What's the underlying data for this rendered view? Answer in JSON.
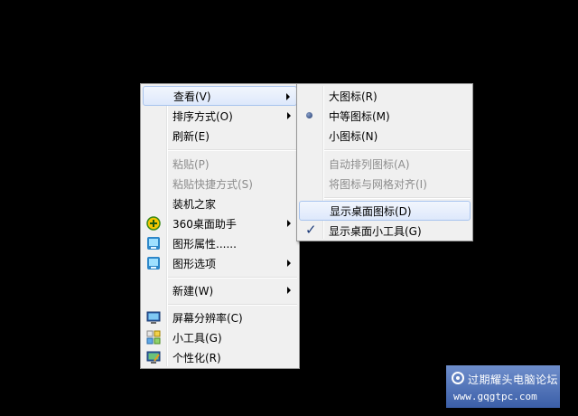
{
  "main_menu": {
    "items": [
      {
        "label": "查看(V)",
        "has_submenu": true,
        "highlighted": true,
        "disabled": false
      },
      {
        "label": "排序方式(O)",
        "has_submenu": true,
        "disabled": false
      },
      {
        "label": "刷新(E)",
        "disabled": false
      },
      {
        "label": "粘贴(P)",
        "disabled": true
      },
      {
        "label": "粘贴快捷方式(S)",
        "disabled": true
      },
      {
        "label": "装机之家",
        "disabled": false
      },
      {
        "label": "360桌面助手",
        "has_submenu": true,
        "icon": "360-assistant-icon",
        "disabled": false
      },
      {
        "label": "图形属性......",
        "icon": "graphics-properties-icon",
        "disabled": false
      },
      {
        "label": "图形选项",
        "has_submenu": true,
        "icon": "graphics-options-icon",
        "disabled": false
      },
      {
        "label": "新建(W)",
        "has_submenu": true,
        "disabled": false
      },
      {
        "label": "屏幕分辨率(C)",
        "icon": "screen-resolution-icon",
        "disabled": false
      },
      {
        "label": "小工具(G)",
        "icon": "gadgets-icon",
        "disabled": false
      },
      {
        "label": "个性化(R)",
        "icon": "personalize-icon",
        "disabled": false
      }
    ]
  },
  "view_submenu": {
    "items": [
      {
        "label": "大图标(R)",
        "disabled": false
      },
      {
        "label": "中等图标(M)",
        "selected": true,
        "marker": "radio-bullet",
        "disabled": false
      },
      {
        "label": "小图标(N)",
        "disabled": false
      },
      {
        "label": "自动排列图标(A)",
        "disabled": true
      },
      {
        "label": "将图标与网格对齐(I)",
        "disabled": true
      },
      {
        "label": "显示桌面图标(D)",
        "highlighted": true,
        "disabled": false
      },
      {
        "label": "显示桌面小工具(G)",
        "checked": true,
        "marker": "✓",
        "disabled": false
      }
    ]
  },
  "watermark": {
    "title": "过期耀头电脑论坛",
    "url": "www.gqgtpc.com"
  },
  "colors": {
    "desktop_background": "#000000",
    "menu_background": "#f0f0f0",
    "highlight_border": "#a8c4ee",
    "disabled_text": "#8d8d8d"
  }
}
